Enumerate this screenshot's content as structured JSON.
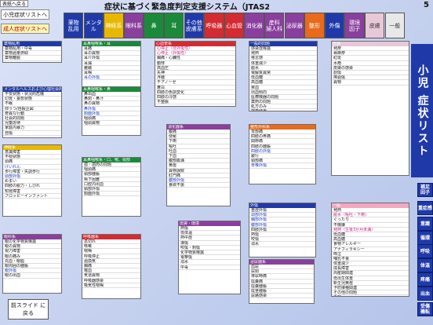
{
  "nav": {
    "top_label": "表紙へ戻る",
    "list_label": "小児症状リストへ",
    "adult_label": "成人症状リストへ"
  },
  "title": "症状に基づく緊急度判定支援システム（JTAS2012）",
  "page_number": "5",
  "tabs": [
    {
      "label": "薬物\n乱用",
      "bg": "#1f3aa8",
      "fg": "#ffffff"
    },
    {
      "label": "メンタ\nル",
      "bg": "#1f3aa8",
      "fg": "#ffffff"
    },
    {
      "label": "神経系",
      "bg": "#e8b800",
      "fg": "#ffffff"
    },
    {
      "label": "眼科系",
      "bg": "#8a3f9e",
      "fg": "#ffffff"
    },
    {
      "label": "鼻",
      "bg": "#1a8a3a",
      "fg": "#ffffff"
    },
    {
      "label": "耳",
      "bg": "#1a8a3a",
      "fg": "#ffffff"
    },
    {
      "label": "その他\n皮膚系",
      "bg": "#1f3aa8",
      "fg": "#ffffff"
    },
    {
      "label": "呼吸器",
      "bg": "#d42a32",
      "fg": "#ffffff"
    },
    {
      "label": "心血管",
      "bg": "#d42a32",
      "fg": "#ffffff"
    },
    {
      "label": "消化器",
      "bg": "#8a3f9e",
      "fg": "#ffffff"
    },
    {
      "label": "産科\n婦人科",
      "bg": "#8a3f9e",
      "fg": "#ffffff"
    },
    {
      "label": "泌尿器",
      "bg": "#8a3f9e",
      "fg": "#ffffff"
    },
    {
      "label": "整形",
      "bg": "#e86a1a",
      "fg": "#ffffff"
    },
    {
      "label": "外傷",
      "bg": "#1f3aa8",
      "fg": "#ffffff"
    },
    {
      "label": "環境\n因子",
      "bg": "#8a3f9e",
      "fg": "#ffffff"
    },
    {
      "label": "皮膚",
      "bg": "#e8c8d8",
      "fg": "#333333"
    },
    {
      "label": "一般",
      "bg": "#e8e8e8",
      "fg": "#333333"
    }
  ],
  "vertical_title": "小児 症状リスト",
  "side_buttons": [
    "補足\n因子",
    "重症感",
    "意識",
    "循環",
    "呼吸",
    "体温",
    "疼痛",
    "出血",
    "受傷\n機転"
  ],
  "back_button": "前スライド\nに戻る",
  "boxes": [
    {
      "title": "薬物乱用",
      "color": "#1f3aa8",
      "items": [
        {
          "t": "薬物乱用・中毒",
          "c": ""
        },
        {
          "t": "薬物過量摂取",
          "c": ""
        },
        {
          "t": "薬物離脱",
          "c": ""
        }
      ]
    },
    {
      "title": "メンタルヘルスおよび心理社会的問題",
      "color": "#1f3aa8",
      "items": [
        {
          "t": "不安状態・状況的危機",
          "c": ""
        },
        {
          "t": "幻覚・妄想状態",
          "c": ""
        },
        {
          "t": "不眠",
          "c": ""
        },
        {
          "t": "抑うつ/自殺企図",
          "c": ""
        },
        {
          "t": "奇異な行動",
          "c": ""
        },
        {
          "t": "社会的問題",
          "c": ""
        },
        {
          "t": "児童虐待",
          "c": ""
        },
        {
          "t": "家庭内暴力",
          "c": ""
        },
        {
          "t": "自傷",
          "c": ""
        }
      ]
    },
    {
      "title": "神経系",
      "color": "#e8b800",
      "items": [
        {
          "t": "意識障害",
          "c": ""
        },
        {
          "t": "不穏状態",
          "c": ""
        },
        {
          "t": "頭痛",
          "c": ""
        },
        {
          "t": "けいれん",
          "c": "blue"
        },
        {
          "t": "歩行障害・失調歩行",
          "c": ""
        },
        {
          "t": "頭部外傷",
          "c": "blue"
        },
        {
          "t": "めまい",
          "c": ""
        },
        {
          "t": "四肢の脱力・しびれ",
          "c": ""
        },
        {
          "t": "知覚障害",
          "c": ""
        },
        {
          "t": "フロッピーインファント",
          "c": ""
        }
      ]
    },
    {
      "title": "眼科系",
      "color": "#8a3f9e",
      "items": [
        {
          "t": "眼の化学物質曝露",
          "c": ""
        },
        {
          "t": "眼の異物",
          "c": ""
        },
        {
          "t": "視力障害",
          "c": ""
        },
        {
          "t": "眼の痛み",
          "c": ""
        },
        {
          "t": "充血・眼脂",
          "c": ""
        },
        {
          "t": "眼周囲の腫脹",
          "c": ""
        },
        {
          "t": "眼外傷",
          "c": "blue"
        },
        {
          "t": "眼の出血",
          "c": ""
        }
      ]
    },
    {
      "title": "耳鼻咽喉系・耳",
      "color": "#1a8a3a",
      "items": [
        {
          "t": "耳痛",
          "c": ""
        },
        {
          "t": "耳の異物",
          "c": ""
        },
        {
          "t": "耳介外傷",
          "c": ""
        },
        {
          "t": "耳漏",
          "c": ""
        },
        {
          "t": "難聴",
          "c": ""
        },
        {
          "t": "耳鳴",
          "c": ""
        },
        {
          "t": "耳の外傷",
          "c": "blue"
        }
      ]
    },
    {
      "title": "耳鼻咽喉系・鼻",
      "color": "#1a8a3a",
      "items": [
        {
          "t": "鼻出血",
          "c": ""
        },
        {
          "t": "鼻閉・鼻汁",
          "c": ""
        },
        {
          "t": "鼻の異物",
          "c": ""
        },
        {
          "t": "鼻外傷",
          "c": "blue"
        },
        {
          "t": "顔面外傷",
          "c": "blue"
        },
        {
          "t": "咽頭痛",
          "c": ""
        },
        {
          "t": "咽頭異物",
          "c": ""
        }
      ]
    },
    {
      "title": "耳鼻咽喉系・口、喉、頸部",
      "color": "#1a8a3a",
      "items": [
        {
          "t": "歯・歯肉の問題",
          "c": ""
        },
        {
          "t": "咽頭痛",
          "c": ""
        },
        {
          "t": "頸部腫脹",
          "c": ""
        },
        {
          "t": "嚥下困難",
          "c": ""
        },
        {
          "t": "口腔内出血",
          "c": ""
        },
        {
          "t": "頸部外傷",
          "c": ""
        },
        {
          "t": "顔面外傷",
          "c": ""
        }
      ]
    },
    {
      "title": "呼吸器系",
      "color": "#d42a32",
      "items": [
        {
          "t": "息切れ",
          "c": ""
        },
        {
          "t": "咳嗽",
          "c": ""
        },
        {
          "t": "喘鳴",
          "c": ""
        },
        {
          "t": "呼吸停止",
          "c": ""
        },
        {
          "t": "過換気",
          "c": ""
        },
        {
          "t": "胸痛",
          "c": ""
        },
        {
          "t": "喀血",
          "c": ""
        },
        {
          "t": "気道異物",
          "c": ""
        },
        {
          "t": "呼吸器感染",
          "c": ""
        },
        {
          "t": "吸気性喘鳴",
          "c": ""
        }
      ]
    },
    {
      "title": "心血管系",
      "color": "#d42a32",
      "items": [
        {
          "t": "心停止（非外傷性）",
          "c": "pink"
        },
        {
          "t": "心停止（外傷性）",
          "c": "pink"
        },
        {
          "t": "胸痛・心臓性",
          "c": ""
        },
        {
          "t": "動悸",
          "c": ""
        },
        {
          "t": "高血圧",
          "c": ""
        },
        {
          "t": "失神",
          "c": ""
        },
        {
          "t": "浮腫",
          "c": ""
        },
        {
          "t": "チアノーゼ",
          "c": ""
        },
        {
          "t": "蒼白",
          "c": ""
        },
        {
          "t": "四肢の色調変化",
          "c": ""
        },
        {
          "t": "四肢の冷感",
          "c": ""
        },
        {
          "t": "不整脈",
          "c": ""
        }
      ]
    },
    {
      "title": "消化器系",
      "color": "#8a3f9e",
      "items": [
        {
          "t": "腹痛",
          "c": ""
        },
        {
          "t": "便秘",
          "c": ""
        },
        {
          "t": "下痢",
          "c": ""
        },
        {
          "t": "嘔吐",
          "c": ""
        },
        {
          "t": "吐血",
          "c": ""
        },
        {
          "t": "下血",
          "c": ""
        },
        {
          "t": "腹部膨満",
          "c": ""
        },
        {
          "t": "黄疸",
          "c": ""
        },
        {
          "t": "異物誤飲",
          "c": ""
        },
        {
          "t": "肛門痛",
          "c": ""
        },
        {
          "t": "腹部外傷",
          "c": "blue"
        },
        {
          "t": "食欲不振",
          "c": ""
        }
      ]
    },
    {
      "title": "整形外科系",
      "color": "#e86a1a",
      "items": [
        {
          "t": "背部痛",
          "c": ""
        },
        {
          "t": "四肢の疼痛",
          "c": ""
        },
        {
          "t": "関節痛",
          "c": ""
        },
        {
          "t": "四肢の腫脹",
          "c": ""
        },
        {
          "t": "四肢の外傷",
          "c": "blue"
        },
        {
          "t": "跛行",
          "c": ""
        },
        {
          "t": "頸部痛",
          "c": ""
        },
        {
          "t": "脊椎外傷",
          "c": "blue"
        }
      ]
    },
    {
      "title": "外傷",
      "color": "#1f3aa8",
      "items": [
        {
          "t": "重症外傷",
          "c": ""
        },
        {
          "t": "頭部外傷",
          "c": "blue"
        },
        {
          "t": "胸部外傷",
          "c": "blue"
        },
        {
          "t": "腹部外傷",
          "c": "blue"
        },
        {
          "t": "四肢外傷",
          "c": ""
        },
        {
          "t": "熱傷",
          "c": ""
        },
        {
          "t": "咬傷",
          "c": ""
        },
        {
          "t": "溺水",
          "c": ""
        }
      ]
    },
    {
      "title": "皮膚・環境",
      "color": "#8a3f9e",
      "items": [
        {
          "t": "熱傷",
          "c": ""
        },
        {
          "t": "低体温",
          "c": ""
        },
        {
          "t": "熱中症",
          "c": ""
        },
        {
          "t": "凍傷",
          "c": ""
        },
        {
          "t": "咬傷・刺傷",
          "c": ""
        },
        {
          "t": "化学物質曝露",
          "c": ""
        },
        {
          "t": "電撃傷",
          "c": ""
        },
        {
          "t": "溺水",
          "c": ""
        },
        {
          "t": "中毒",
          "c": ""
        }
      ]
    },
    {
      "title": "泌尿器系",
      "color": "#8a3f9e",
      "items": [
        {
          "t": "血尿",
          "c": ""
        },
        {
          "t": "尿閉",
          "c": ""
        },
        {
          "t": "排尿時痛",
          "c": ""
        },
        {
          "t": "陰嚢痛",
          "c": ""
        },
        {
          "t": "陰嚢腫脹",
          "c": ""
        },
        {
          "t": "陰茎腫脹",
          "c": ""
        },
        {
          "t": "尿路感染",
          "c": ""
        }
      ]
    },
    {
      "title": "皮膚",
      "color": "#e8c8d8",
      "items": [
        {
          "t": "発疹",
          "c": ""
        },
        {
          "t": "蕁麻疹",
          "c": ""
        },
        {
          "t": "紅斑",
          "c": ""
        },
        {
          "t": "水疱",
          "c": ""
        },
        {
          "t": "皮膚の感染",
          "c": ""
        },
        {
          "t": "創傷",
          "c": ""
        },
        {
          "t": "擦過傷",
          "c": ""
        },
        {
          "t": "異物",
          "c": ""
        }
      ]
    },
    {
      "title": "一般",
      "color": "#f4a7c1",
      "items": [
        {
          "t": "発熱",
          "c": ""
        },
        {
          "t": "脱水（嘔吐・下痢）",
          "c": "pink"
        },
        {
          "t": "ぐったり",
          "c": ""
        },
        {
          "t": "不機嫌",
          "c": ""
        },
        {
          "t": "発熱（生後3か月未満）",
          "c": "pink"
        },
        {
          "t": "低血糖",
          "c": ""
        },
        {
          "t": "高血糖",
          "c": ""
        },
        {
          "t": "食物アレルギー",
          "c": ""
        },
        {
          "t": "アナフィラキシー",
          "c": ""
        },
        {
          "t": "啼泣",
          "c": ""
        },
        {
          "t": "哺乳不良",
          "c": ""
        },
        {
          "t": "体重減少",
          "c": ""
        },
        {
          "t": "成長障害",
          "c": ""
        },
        {
          "t": "周産期関連",
          "c": ""
        },
        {
          "t": "低出生体重",
          "c": ""
        },
        {
          "t": "新生児黄疸",
          "c": ""
        },
        {
          "t": "予防接種関連",
          "c": ""
        },
        {
          "t": "その他の問題",
          "c": ""
        },
        {
          "t": "再診",
          "c": ""
        },
        {
          "t": "検査・処置のみ",
          "c": ""
        },
        {
          "t": "処方のみ",
          "c": ""
        },
        {
          "t": "診断書",
          "c": ""
        },
        {
          "t": "相談",
          "c": ""
        },
        {
          "t": "医療機器",
          "c": ""
        },
        {
          "t": "その他",
          "c": ""
        }
      ]
    },
    {
      "title": "一般的問題",
      "color": "#1f3aa8",
      "items": [
        {
          "t": "感染症曝露",
          "c": ""
        },
        {
          "t": "発熱",
          "c": ""
        },
        {
          "t": "倦怠感",
          "c": ""
        },
        {
          "t": "体重減少",
          "c": ""
        },
        {
          "t": "脱水",
          "c": ""
        },
        {
          "t": "電解質異常",
          "c": ""
        },
        {
          "t": "低血糖",
          "c": ""
        },
        {
          "t": "高血糖",
          "c": ""
        },
        {
          "t": "貧血",
          "c": ""
        },
        {
          "t": "出血傾向",
          "c": ""
        },
        {
          "t": "医療機器の問題",
          "c": ""
        },
        {
          "t": "薬剤の問題",
          "c": ""
        },
        {
          "t": "処方のみ",
          "c": ""
        },
        {
          "t": "検査結果",
          "c": ""
        },
        {
          "t": "創傷処置",
          "c": ""
        },
        {
          "t": "その他",
          "c": ""
        }
      ]
    }
  ]
}
